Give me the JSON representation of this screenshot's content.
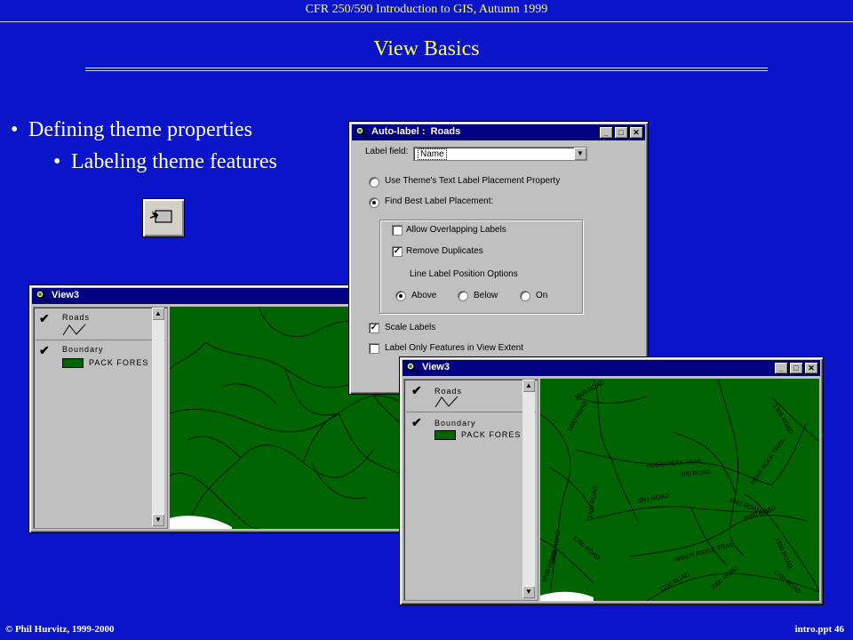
{
  "slide": {
    "course_title": "CFR 250/590 Introduction to GIS, Autumn 1999",
    "title": "View Basics",
    "bullets": [
      "Defining theme properties",
      "Labeling theme features"
    ],
    "footer_left": "© Phil Hurvitz, 1999-2000",
    "footer_right": "intro.ppt 46",
    "colors": {
      "background": "#0a14c8",
      "title": "#ffff44",
      "text": "#ffffff",
      "map": "#006400",
      "titlebar": "#000080"
    }
  },
  "tool_button": {
    "icon": "label-tool-icon"
  },
  "view_back": {
    "title": "View3",
    "themes": [
      {
        "name": "Roads",
        "checked": true,
        "symbol": "line-symbol-icon"
      },
      {
        "name": "Boundary",
        "checked": true,
        "legend_label": "PACK FORES"
      }
    ]
  },
  "auto_label": {
    "title": "Auto-label :  Roads",
    "label_field_label": "Label field:",
    "label_field_value": "Name",
    "option_theme_placement": "Use Theme's Text Label Placement Property",
    "option_best_placement": "Find Best Label Placement:",
    "allow_overlapping": "Allow Overlapping Labels",
    "remove_duplicates": "Remove Duplicates",
    "line_label_options": "Line Label Position Options",
    "pos_above": "Above",
    "pos_below": "Below",
    "pos_on": "On",
    "scale_labels": "Scale Labels",
    "label_only_extent": "Label Only Features in View Extent"
  },
  "view_front": {
    "title": "View3",
    "themes": [
      {
        "name": "Roads",
        "checked": true,
        "symbol": "line-symbol-icon"
      },
      {
        "name": "Boundary",
        "checked": true,
        "legend_label": "PACK FORES"
      }
    ],
    "map_labels": {
      "r1600a": "1600 ROAD",
      "r1400": "1400 ROAD",
      "r1600b": "1600 ROAD",
      "r1200": "1200 ROAD",
      "r1081": "1081 ROAD",
      "hugo": "HUGO PEAK TRAIL",
      "r300": "300 ROAD",
      "r2000": "2000 ROAD",
      "r1081b": "1081 ROAD",
      "rbear": "BEAR ROCK TRAIL",
      "r1300": "1300 ROAD",
      "windy": "WINDY RIDGE TRAIL",
      "r1200b": "1200 ROAD",
      "r2000b": "2000 ROAD",
      "r1500": "1500 ROAD",
      "r1700": "1700 ROAD",
      "r1900": "1900 ROAD",
      "r1800": "1800 ROAD"
    }
  }
}
